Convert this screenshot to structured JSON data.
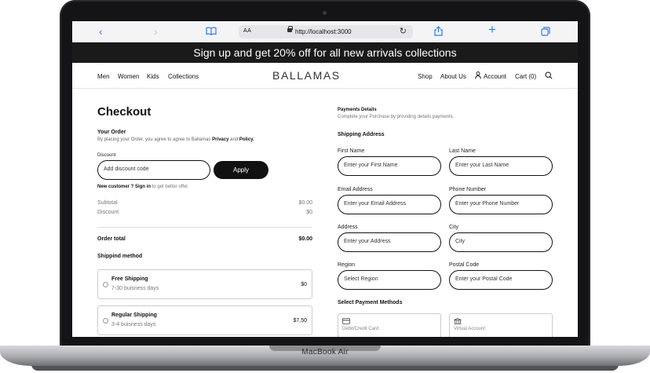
{
  "device": {
    "label": "MacBook Air"
  },
  "browser": {
    "text_size_label": "AA",
    "url": "http://localhost:3000",
    "icons": [
      "back-icon",
      "forward-icon",
      "bookmarks-icon",
      "lock-icon",
      "reload-icon",
      "share-icon",
      "new-tab-icon",
      "tabs-icon"
    ]
  },
  "promo": {
    "text": "Sign up and get 20% off for all new arrivals collections"
  },
  "nav": {
    "left": [
      "Men",
      "Women",
      "Kids",
      "Collections"
    ],
    "logo": "BALLAMAS",
    "shop": "Shop",
    "about": "About Us",
    "account": "Account",
    "cart": "Cart (0)"
  },
  "checkout": {
    "title": "Checkout",
    "your_order": "Your Order",
    "order_note_prefix": "By placing your Order, you agree to agree to Ballamas",
    "privacy": "Privacy",
    "and": "and",
    "policy": "Policy.",
    "discount_label": "Discount",
    "discount_placeholder": "Add discount code",
    "apply": "Apply",
    "new_customer": "New customer ?",
    "sign_in": "Sign in",
    "sign_in_suffix": "to get better offer.",
    "subtotal_label": "Subtotal",
    "subtotal_value": "$0.00",
    "discount_row_label": "Discount",
    "discount_row_value": "$0",
    "order_total_label": "Order total",
    "order_total_value": "$0.00",
    "shipping_method_label": "Shippind method",
    "shipping_options": [
      {
        "name": "Free Shipping",
        "days": "7-30 buisness days",
        "price": "$0"
      },
      {
        "name": "Regular Shipping",
        "days": "3-4 buisness days",
        "price": "$7,50"
      }
    ]
  },
  "payment": {
    "title": "Payments Details",
    "subtitle": "Complete your Purchase by providing details payments.",
    "shipping_address": "Shipping Address",
    "first_name_label": "First Name",
    "first_name_placeholder": "Enter your First Name",
    "last_name_label": "Last Name",
    "last_name_placeholder": "Enter your Last Name",
    "email_label": "Email Address",
    "email_placeholder": "Enter your Email Address",
    "phone_label": "Phone Number",
    "phone_placeholder": "Enter your Phone Number",
    "address_label": "Address",
    "address_placeholder": "Enter your Address",
    "city_label": "City",
    "city_placeholder": "City",
    "region_label": "Region",
    "region_placeholder": "Select Region",
    "postal_label": "Postal Code",
    "postal_placeholder": "Enter your Postal Code",
    "methods_label": "Select Payment Methods",
    "methods": [
      {
        "label": "Debit/Credit Card",
        "icon": "card-icon"
      },
      {
        "label": "Virtual Account",
        "icon": "bank-icon"
      }
    ]
  }
}
